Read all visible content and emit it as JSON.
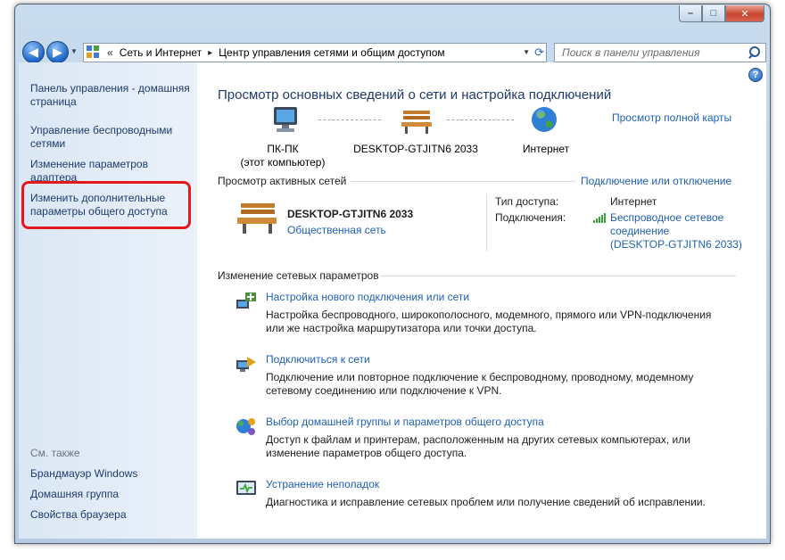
{
  "window": {
    "minimize": "–",
    "maximize": "□",
    "close": "✕"
  },
  "nav": {
    "back_icon": "◀",
    "forward_icon": "▶",
    "chevron": "«",
    "crumbs": [
      "Сеть и Интернет",
      "Центр управления сетями и общим доступом"
    ],
    "separator": "▸",
    "search_placeholder": "Поиск в панели управления"
  },
  "sidebar": {
    "items": [
      {
        "label": "Панель управления - домашняя страница"
      },
      {
        "label": "Управление беспроводными сетями"
      },
      {
        "label": "Изменение параметров адаптера"
      },
      {
        "label": "Изменить дополнительные параметры общего доступа"
      }
    ],
    "see_also": "См. также",
    "links": [
      "Брандмауэр Windows",
      "Домашняя группа",
      "Свойства браузера"
    ]
  },
  "help": "?",
  "main": {
    "title": "Просмотр основных сведений о сети и настройка подключений",
    "full_map_link": "Просмотр полной карты",
    "map": {
      "pc_line1": "ПК-ПК",
      "pc_line2": "(этот компьютер)",
      "network": "DESKTOP-GTJITN6 2033",
      "internet": "Интернет"
    },
    "active_networks": {
      "label": "Просмотр активных сетей",
      "connect_link": "Подключение или отключение",
      "network_name": "DESKTOP-GTJITN6 2033",
      "network_type": "Общественная сеть",
      "access_label": "Тип доступа:",
      "access_value": "Интернет",
      "connections_label": "Подключения:",
      "connection_line1": "Беспроводное сетевое",
      "connection_line2": "соединение",
      "connection_line3": "(DESKTOP-GTJITN6 2033)"
    },
    "change_settings": {
      "label": "Изменение сетевых параметров",
      "tasks": [
        {
          "icon": "new-connection-icon",
          "title": "Настройка нового подключения или сети",
          "desc1": "Настройка беспроводного, широкополосного, модемного, прямого или VPN-подключения",
          "desc2": "или же настройка маршрутизатора или точки доступа."
        },
        {
          "icon": "connect-network-icon",
          "title": "Подключиться к сети",
          "desc1": "Подключение или повторное подключение к беспроводному, проводному, модемному",
          "desc2": "сетевому соединению или подключение к VPN."
        },
        {
          "icon": "homegroup-icon",
          "title": "Выбор домашней группы и параметров общего доступа",
          "desc1": "Доступ к файлам и принтерам, расположенным на других сетевых компьютерах, или",
          "desc2": "изменение параметров общего доступа."
        },
        {
          "icon": "troubleshoot-icon",
          "title": "Устранение неполадок",
          "desc1": "Диагностика и исправление сетевых проблем или получение сведений об исправлении.",
          "desc2": ""
        }
      ]
    }
  },
  "colors": {
    "link": "#1f5fb4",
    "title": "#1e3a6d",
    "highlight": "#e3191c"
  }
}
